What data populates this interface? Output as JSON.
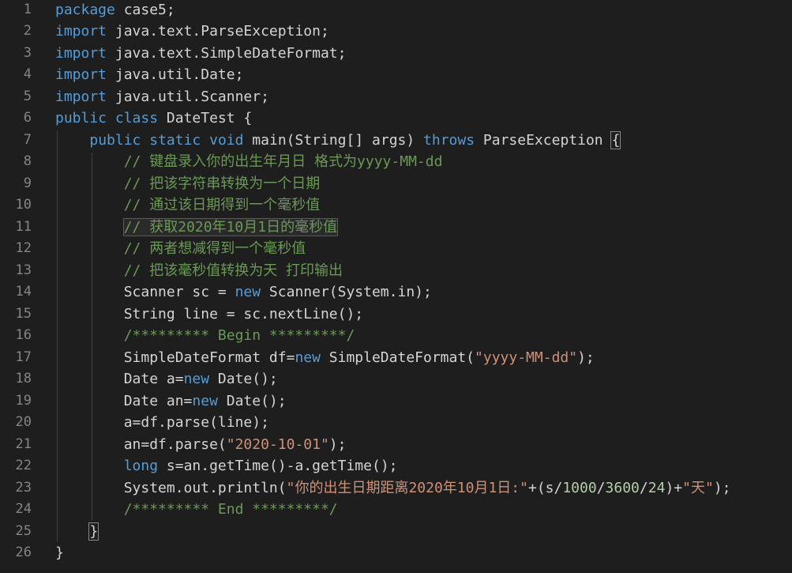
{
  "editor": {
    "lines": [
      {
        "num": "1",
        "tokens": [
          {
            "t": "package",
            "c": "kw"
          },
          {
            "t": " case5;",
            "c": "plain"
          }
        ]
      },
      {
        "num": "2",
        "tokens": [
          {
            "t": "import",
            "c": "kw"
          },
          {
            "t": " java.text.ParseException;",
            "c": "plain"
          }
        ]
      },
      {
        "num": "3",
        "tokens": [
          {
            "t": "import",
            "c": "kw"
          },
          {
            "t": " java.text.SimpleDateFormat;",
            "c": "plain"
          }
        ]
      },
      {
        "num": "4",
        "tokens": [
          {
            "t": "import",
            "c": "kw"
          },
          {
            "t": " java.util.Date;",
            "c": "plain"
          }
        ]
      },
      {
        "num": "5",
        "tokens": [
          {
            "t": "import",
            "c": "kw"
          },
          {
            "t": " java.util.Scanner;",
            "c": "plain"
          }
        ]
      },
      {
        "num": "6",
        "tokens": [
          {
            "t": "public",
            "c": "kw"
          },
          {
            "t": " ",
            "c": "plain"
          },
          {
            "t": "class",
            "c": "kw"
          },
          {
            "t": " DateTest {",
            "c": "plain"
          }
        ]
      },
      {
        "num": "7",
        "tokens": [
          {
            "t": "    ",
            "c": "plain"
          },
          {
            "t": "public",
            "c": "kw"
          },
          {
            "t": " ",
            "c": "plain"
          },
          {
            "t": "static",
            "c": "kw"
          },
          {
            "t": " ",
            "c": "plain"
          },
          {
            "t": "void",
            "c": "kw"
          },
          {
            "t": " main(String[] args) ",
            "c": "plain"
          },
          {
            "t": "throws",
            "c": "kw"
          },
          {
            "t": " ParseException ",
            "c": "plain"
          },
          {
            "t": "{",
            "c": "bracket"
          }
        ]
      },
      {
        "num": "8",
        "tokens": [
          {
            "t": "        // 键盘录入你的出生年月日 格式为yyyy-MM-dd",
            "c": "com"
          }
        ]
      },
      {
        "num": "9",
        "tokens": [
          {
            "t": "        // 把该字符串转换为一个日期",
            "c": "com"
          }
        ]
      },
      {
        "num": "10",
        "tokens": [
          {
            "t": "        // 通过该日期得到一个毫秒值",
            "c": "com"
          }
        ]
      },
      {
        "num": "11",
        "tokens": [
          {
            "t": "        // 获取2020年10月1日的毫秒值",
            "c": "com",
            "box": true
          }
        ]
      },
      {
        "num": "12",
        "tokens": [
          {
            "t": "        // 两者想减得到一个毫秒值",
            "c": "com"
          }
        ]
      },
      {
        "num": "13",
        "tokens": [
          {
            "t": "        // 把该毫秒值转换为天 打印输出",
            "c": "com"
          }
        ]
      },
      {
        "num": "14",
        "tokens": [
          {
            "t": "        Scanner sc = ",
            "c": "plain"
          },
          {
            "t": "new",
            "c": "kw"
          },
          {
            "t": " Scanner(System.in);",
            "c": "plain"
          }
        ]
      },
      {
        "num": "15",
        "tokens": [
          {
            "t": "        String line = sc.nextLine();",
            "c": "plain"
          }
        ]
      },
      {
        "num": "16",
        "tokens": [
          {
            "t": "        /********* Begin *********/",
            "c": "com"
          }
        ]
      },
      {
        "num": "17",
        "tokens": [
          {
            "t": "        SimpleDateFormat df=",
            "c": "plain"
          },
          {
            "t": "new",
            "c": "kw"
          },
          {
            "t": " SimpleDateFormat(",
            "c": "plain"
          },
          {
            "t": "\"yyyy-MM-dd\"",
            "c": "str"
          },
          {
            "t": ");",
            "c": "plain"
          }
        ]
      },
      {
        "num": "18",
        "tokens": [
          {
            "t": "        Date a=",
            "c": "plain"
          },
          {
            "t": "new",
            "c": "kw"
          },
          {
            "t": " Date();",
            "c": "plain"
          }
        ]
      },
      {
        "num": "19",
        "tokens": [
          {
            "t": "        Date an=",
            "c": "plain"
          },
          {
            "t": "new",
            "c": "kw"
          },
          {
            "t": " Date();",
            "c": "plain"
          }
        ]
      },
      {
        "num": "20",
        "tokens": [
          {
            "t": "        a=df.parse(line);",
            "c": "plain"
          }
        ]
      },
      {
        "num": "21",
        "tokens": [
          {
            "t": "        an=df.parse(",
            "c": "plain"
          },
          {
            "t": "\"2020-10-01\"",
            "c": "str"
          },
          {
            "t": ");",
            "c": "plain"
          }
        ]
      },
      {
        "num": "22",
        "tokens": [
          {
            "t": "        ",
            "c": "plain"
          },
          {
            "t": "long",
            "c": "kw"
          },
          {
            "t": " s=an.getTime()-a.getTime();",
            "c": "plain"
          }
        ]
      },
      {
        "num": "23",
        "tokens": [
          {
            "t": "        System.out.println(",
            "c": "plain"
          },
          {
            "t": "\"你的出生日期距离2020年10月1日:\"",
            "c": "str"
          },
          {
            "t": "+(s/",
            "c": "plain"
          },
          {
            "t": "1000",
            "c": "num"
          },
          {
            "t": "/",
            "c": "plain"
          },
          {
            "t": "3600",
            "c": "num"
          },
          {
            "t": "/",
            "c": "plain"
          },
          {
            "t": "24",
            "c": "num"
          },
          {
            "t": ")+",
            "c": "plain"
          },
          {
            "t": "\"天\"",
            "c": "str"
          },
          {
            "t": ");",
            "c": "plain"
          }
        ]
      },
      {
        "num": "24",
        "tokens": [
          {
            "t": "        /********* End *********/",
            "c": "com"
          }
        ]
      },
      {
        "num": "25",
        "tokens": [
          {
            "t": "    ",
            "c": "plain"
          },
          {
            "t": "}",
            "c": "bracket"
          }
        ]
      },
      {
        "num": "26",
        "tokens": [
          {
            "t": "}",
            "c": "plain"
          }
        ]
      }
    ]
  }
}
